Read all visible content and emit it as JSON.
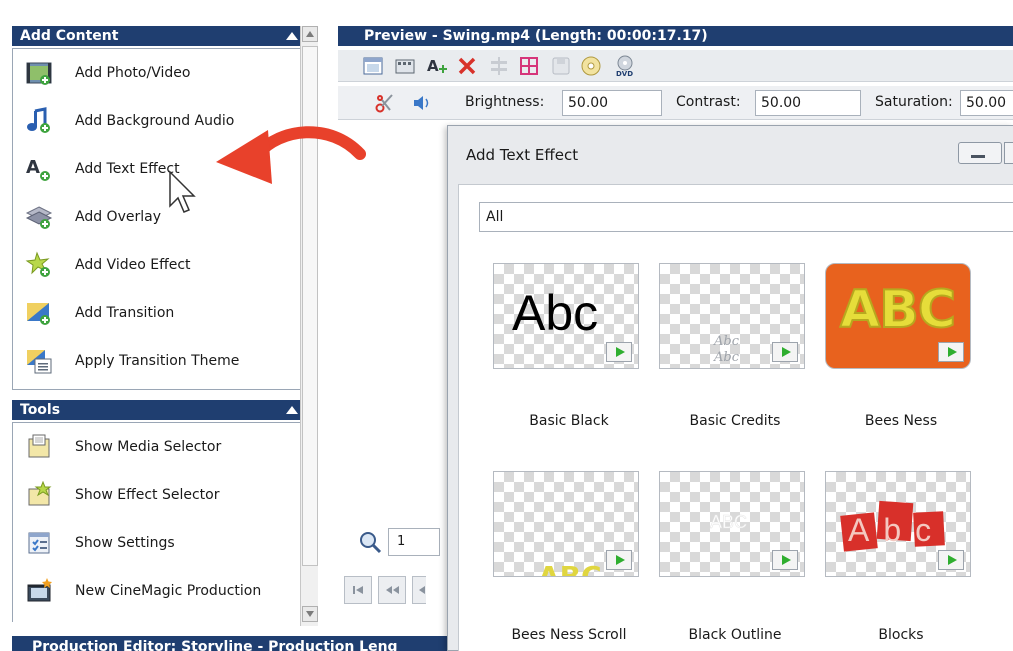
{
  "left_panel": {
    "add_content": {
      "title": "Add Content",
      "items": [
        {
          "label": "Add Photo/Video",
          "icon": "photo-video-icon"
        },
        {
          "label": "Add Background Audio",
          "icon": "audio-note-icon"
        },
        {
          "label": "Add Text Effect",
          "icon": "text-effect-icon"
        },
        {
          "label": "Add Overlay",
          "icon": "overlay-layers-icon"
        },
        {
          "label": "Add Video Effect",
          "icon": "video-effect-icon"
        },
        {
          "label": "Add Transition",
          "icon": "transition-icon"
        },
        {
          "label": "Apply Transition Theme",
          "icon": "transition-theme-icon"
        }
      ]
    },
    "tools": {
      "title": "Tools",
      "items": [
        {
          "label": "Show Media Selector",
          "icon": "media-selector-icon"
        },
        {
          "label": "Show Effect Selector",
          "icon": "effect-selector-icon"
        },
        {
          "label": "Show Settings",
          "icon": "settings-icon"
        },
        {
          "label": "New CineMagic Production",
          "icon": "cinemagic-icon"
        }
      ]
    }
  },
  "production_bar": {
    "title": "Production Editor: Storyline - Production Leng"
  },
  "preview": {
    "title": "Preview - Swing.mp4 (Length: 00:00:17.17)",
    "toolbar_icons": [
      "layout-icon",
      "storyboard-icon",
      "add-text-icon",
      "delete-icon",
      "split-icon",
      "crop-icon",
      "save-icon",
      "disc-icon",
      "dvd-icon"
    ],
    "dvd_label": "DVD",
    "adjust": {
      "brightness_label": "Brightness:",
      "brightness_value": "50.00",
      "contrast_label": "Contrast:",
      "contrast_value": "50.00",
      "saturation_label": "Saturation:",
      "saturation_value": "50.00"
    },
    "zoom_value": "1"
  },
  "dialog": {
    "title": "Add Text Effect",
    "filter_value": "All",
    "effects": [
      {
        "name": "Basic Black",
        "thumb_text": "Abc"
      },
      {
        "name": "Basic Credits",
        "thumb_text": "Abc Abc"
      },
      {
        "name": "Bees Ness",
        "thumb_text": "ABC"
      },
      {
        "name": "Bees Ness Scroll",
        "thumb_text": "ABC"
      },
      {
        "name": "Black Outline",
        "thumb_text": "ABC"
      },
      {
        "name": "Blocks",
        "thumb_text": "Abc"
      }
    ]
  },
  "colors": {
    "header_bg": "#1f3e70",
    "accent_red": "#e8412b",
    "play_green": "#2fae2f"
  }
}
